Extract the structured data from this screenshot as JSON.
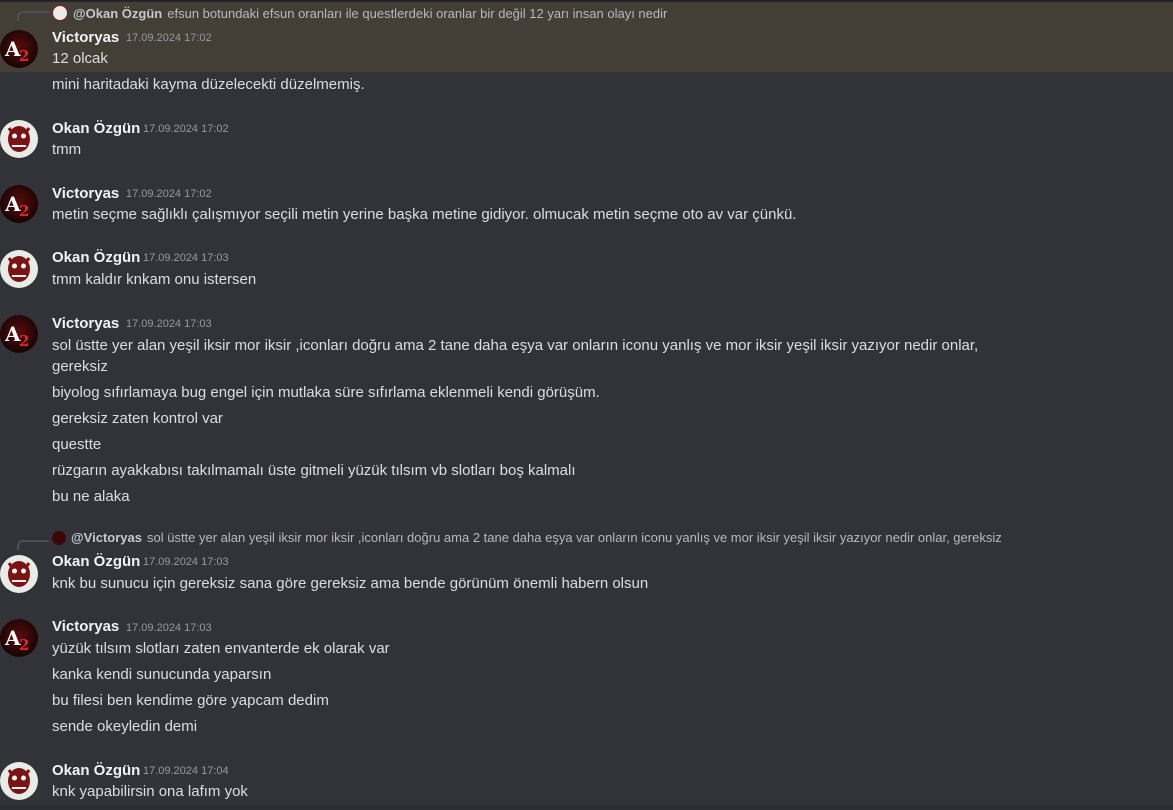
{
  "users": {
    "victoryas": "Victoryas",
    "okan": "Okan Özgün"
  },
  "replies": {
    "r1": {
      "mention": "@Okan Özgün",
      "text": "efsun botundaki efsun oranları ile questlerdeki oranlar bir değil 12 yarı insan olayı nedir"
    },
    "r2": {
      "mention": "@Victoryas",
      "text": "sol üstte yer alan yeşil iksir mor iksir ,iconları doğru ama 2 tane daha eşya var onların iconu yanlış ve mor iksir yeşil iksir yazıyor nedir onlar, gereksiz"
    }
  },
  "messages": {
    "m1": {
      "time": "17.09.2024 17:02",
      "lines": [
        "12 olcak",
        "mini haritadaki kayma düzelecekti düzelmemiş."
      ]
    },
    "m2": {
      "time": "17.09.2024 17:02",
      "lines": [
        "tmm"
      ]
    },
    "m3": {
      "time": "17.09.2024 17:02",
      "lines": [
        "metin seçme sağlıklı çalışmıyor seçili metin yerine başka metine gidiyor. olmucak metin seçme oto av var çünkü."
      ]
    },
    "m4": {
      "time": "17.09.2024 17:03",
      "lines": [
        "tmm kaldır knkam onu istersen"
      ]
    },
    "m5": {
      "time": "17.09.2024 17:03",
      "lines": [
        "sol üstte yer alan yeşil iksir mor iksir ,iconları doğru ama 2 tane daha eşya var onların iconu yanlış ve mor iksir yeşil iksir yazıyor nedir onlar,",
        "gereksiz",
        "biyolog sıfırlamaya bug engel için mutlaka süre sıfırlama eklenmeli kendi görüşüm.",
        "gereksiz zaten kontrol var",
        "questte",
        "rüzgarın ayakkabısı takılmamalı üste gitmeli yüzük tılsım vb slotları boş kalmalı",
        "bu ne alaka"
      ]
    },
    "m6": {
      "time": "17.09.2024 17:03",
      "lines": [
        "knk bu sunucu için gereksiz sana göre gereksiz ama bende görünüm önemli habern olsun"
      ]
    },
    "m7": {
      "time": "17.09.2024 17:03",
      "lines": [
        "yüzük tılsım slotları zaten envanterde ek olarak var",
        "kanka kendi sunucunda yaparsın",
        "bu filesi ben kendime göre yapcam dedim",
        "sende okeyledin demi"
      ]
    },
    "m8": {
      "time": "17.09.2024 17:04",
      "lines": [
        "knk yapabilirsin ona lafım yok"
      ]
    }
  },
  "colors": {
    "background": "#323339",
    "highlight": "#433f36",
    "username": "#f2f3f5",
    "timestamp": "#949ba4",
    "text": "#dbdee1"
  },
  "icons": {
    "victoryas_avatar": "a2-logo-avatar",
    "okan_avatar": "demon-mask-avatar"
  }
}
